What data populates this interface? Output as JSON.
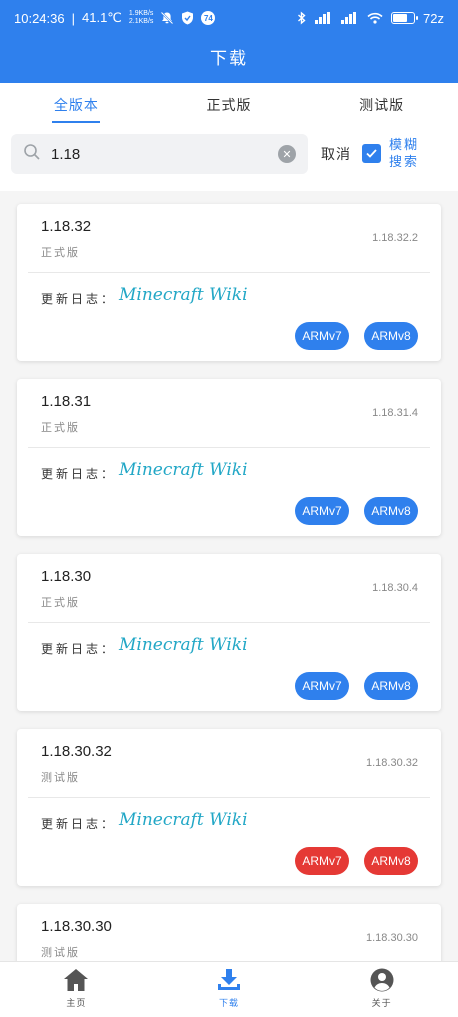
{
  "status_bar": {
    "time": "10:24:36",
    "speed": "41.1℃",
    "net_up": "1.9KB/s",
    "net_down": "2.1KB/s",
    "badge": "74",
    "battery_pct": 72,
    "battery_text": "72z",
    "icons": [
      "bell-off-icon",
      "shield-icon",
      "bluetooth-icon",
      "signal-icon",
      "signal-icon",
      "wifi-icon",
      "battery-icon"
    ]
  },
  "header": {
    "title": "下载"
  },
  "tabs": [
    {
      "label": "全版本",
      "active": true
    },
    {
      "label": "正式版",
      "active": false
    },
    {
      "label": "测试版",
      "active": false
    }
  ],
  "search": {
    "value": "1.18",
    "placeholder": "",
    "cancel_label": "取消",
    "fuzzy_label": "模糊搜索",
    "fuzzy_checked": true
  },
  "log_label": "更新日志：",
  "versions": [
    {
      "name": "1.18.32",
      "kind": "正式版",
      "build": "1.18.32.2",
      "log": "Minecraft Wiki",
      "arm7": "ARMv7",
      "arm8": "ARMv8",
      "color": "#2f80ed"
    },
    {
      "name": "1.18.31",
      "kind": "正式版",
      "build": "1.18.31.4",
      "log": "Minecraft Wiki",
      "arm7": "ARMv7",
      "arm8": "ARMv8",
      "color": "#2f80ed"
    },
    {
      "name": "1.18.30",
      "kind": "正式版",
      "build": "1.18.30.4",
      "log": "Minecraft Wiki",
      "arm7": "ARMv7",
      "arm8": "ARMv8",
      "color": "#2f80ed"
    },
    {
      "name": "1.18.30.32",
      "kind": "测试版",
      "build": "1.18.30.32",
      "log": "Minecraft Wiki",
      "arm7": "ARMv7",
      "arm8": "ARMv8",
      "color": "#e53935"
    },
    {
      "name": "1.18.30.30",
      "kind": "测试版",
      "build": "1.18.30.30",
      "log": "",
      "arm7": "",
      "arm8": "",
      "color": "#e53935"
    }
  ],
  "bottom_nav": [
    {
      "label": "主页",
      "icon": "home-icon",
      "active": false
    },
    {
      "label": "下载",
      "icon": "download-icon",
      "active": true
    },
    {
      "label": "关于",
      "icon": "user-icon",
      "active": false
    }
  ]
}
